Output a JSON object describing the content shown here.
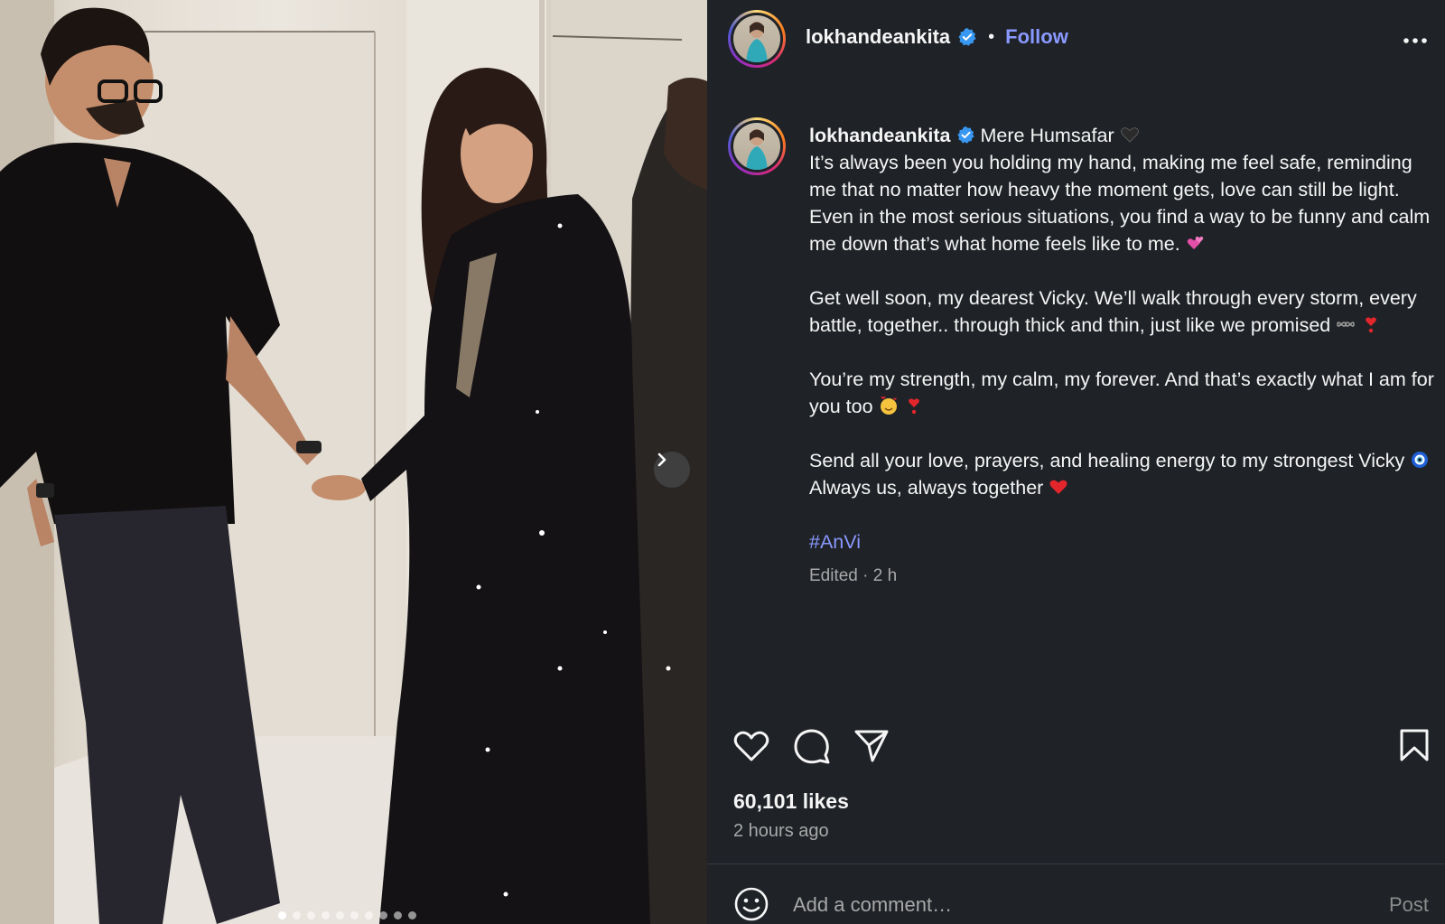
{
  "header": {
    "username": "lokhandeankita",
    "follow_label": "Follow",
    "separator": "•"
  },
  "carousel": {
    "total_slides": 10,
    "active_slide": 1
  },
  "caption": {
    "username": "lokhandeankita",
    "title": "Mere Humsafar",
    "paragraphs": [
      "It’s always been you holding my hand, making me feel safe, reminding me that no matter how heavy the moment gets, love can still be light. Even in the most serious situations, you find a way to be funny and calm me down that’s what home feels like to me.",
      "Get well soon, my dearest Vicky. We’ll walk through every storm, every battle, together.. through thick and thin, just like we promised",
      "You’re my strength, my calm, my forever. And that’s exactly what I am for you too",
      "Send all your love, prayers, and healing energy to my strongest Vicky",
      "Always us, always together"
    ],
    "hashtag": "#AnVi",
    "edited": "Edited · 2 h"
  },
  "icons": {
    "like": "heart-icon",
    "comment": "comment-icon",
    "share": "share-icon",
    "save": "bookmark-icon",
    "more": "more-options-icon",
    "next": "chevron-right-icon",
    "emoji": "emoji-icon",
    "verified": "verified-badge-icon"
  },
  "stats": {
    "likes": "60,101 likes",
    "time_ago": "2 hours ago"
  },
  "comment": {
    "placeholder": "Add a comment…",
    "post_label": "Post"
  },
  "colors": {
    "panel_bg": "#1f2227",
    "link_blue": "#8a99ff",
    "verified_blue": "#3897f0",
    "muted": "#a8a8a8"
  }
}
